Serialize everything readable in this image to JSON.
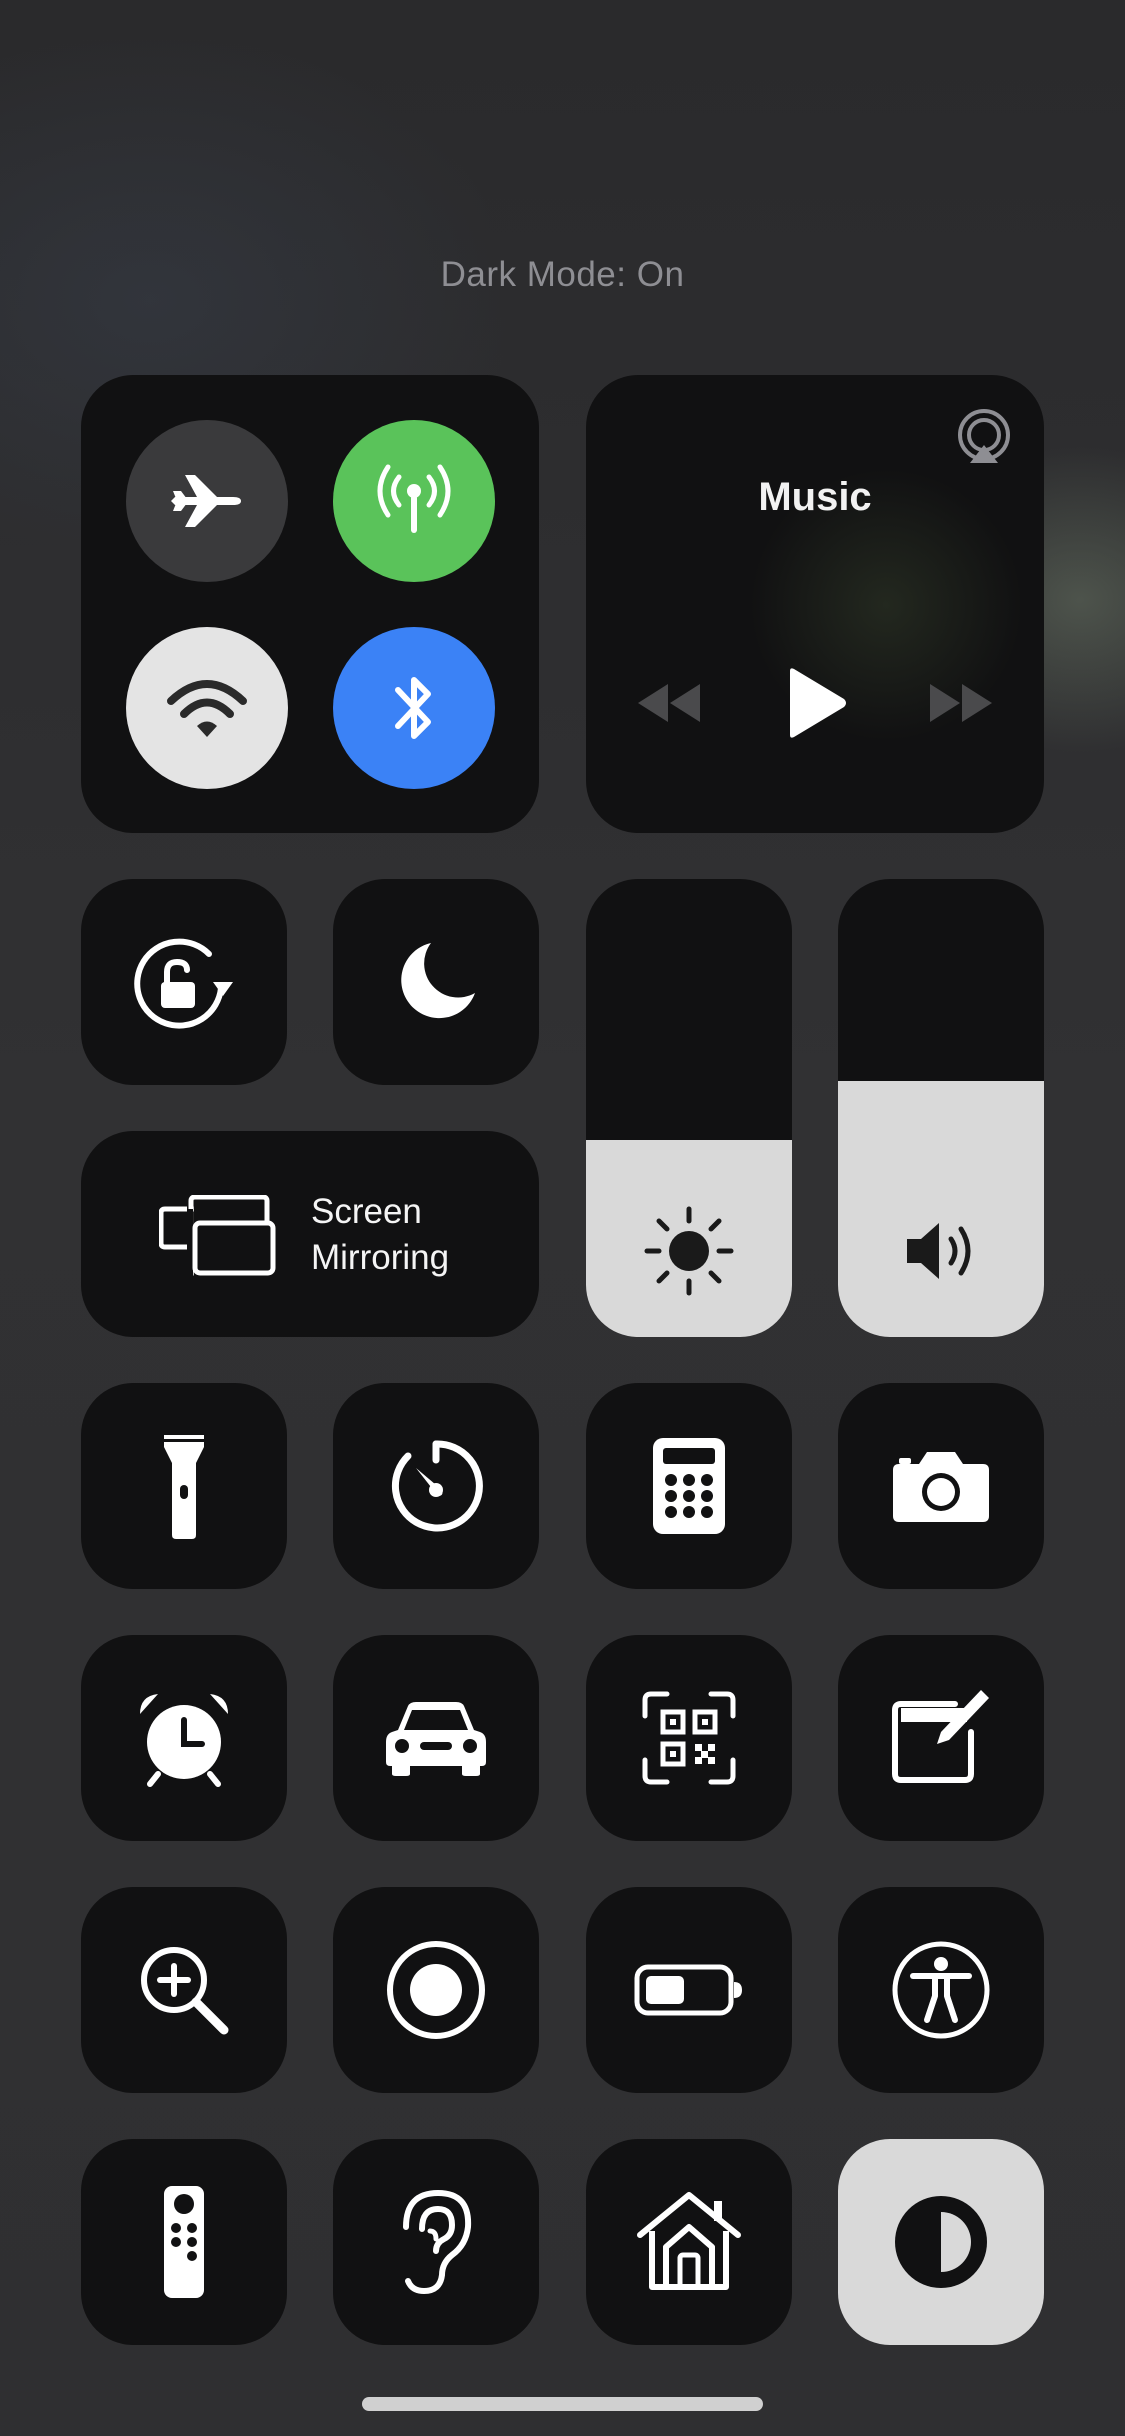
{
  "status": {
    "text": "Dark Mode: On"
  },
  "connectivity": {
    "airplane": {
      "icon": "airplane-icon",
      "on": false
    },
    "cellular": {
      "icon": "cellular-antenna-icon",
      "on": true,
      "color": "#5ac35a"
    },
    "wifi": {
      "icon": "wifi-icon",
      "on": true
    },
    "bluetooth": {
      "icon": "bluetooth-icon",
      "on": true,
      "color": "#3b82f6"
    }
  },
  "music": {
    "title": "Music",
    "icons": [
      "airplay-icon",
      "rewind-icon",
      "play-icon",
      "fast-forward-icon"
    ]
  },
  "toggles": {
    "rotation_lock": {
      "icon": "rotation-lock-icon"
    },
    "do_not_disturb": {
      "icon": "moon-icon"
    }
  },
  "screen_mirroring": {
    "line1": "Screen",
    "line2": "Mirroring",
    "icon": "screen-mirroring-icon"
  },
  "sliders": {
    "brightness": {
      "icon": "sun-icon",
      "level": 0.43
    },
    "volume": {
      "icon": "speaker-icon",
      "level": 0.56
    }
  },
  "controls": [
    {
      "icon": "flashlight-icon"
    },
    {
      "icon": "timer-icon"
    },
    {
      "icon": "calculator-icon"
    },
    {
      "icon": "camera-icon"
    },
    {
      "icon": "alarm-clock-icon"
    },
    {
      "icon": "car-icon"
    },
    {
      "icon": "qr-code-scanner-icon"
    },
    {
      "icon": "notes-icon"
    },
    {
      "icon": "magnifier-icon"
    },
    {
      "icon": "screen-recording-icon"
    },
    {
      "icon": "low-power-battery-icon"
    },
    {
      "icon": "accessibility-icon"
    },
    {
      "icon": "apple-tv-remote-icon"
    },
    {
      "icon": "hearing-icon"
    },
    {
      "icon": "home-icon"
    },
    {
      "icon": "dark-mode-icon",
      "on": true
    }
  ],
  "colors": {
    "background": "#2f2f31",
    "tile": "#111112",
    "tile_active": "#d9d9d9",
    "green": "#5ac35a",
    "blue": "#3b82f6"
  }
}
